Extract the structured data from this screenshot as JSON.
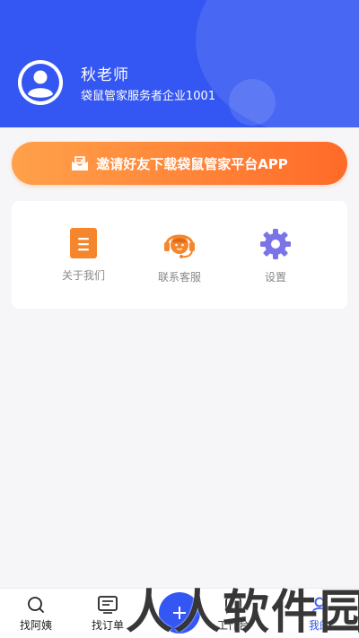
{
  "profile": {
    "name": "秋老师",
    "company": "袋鼠管家服务者企业1001"
  },
  "invite_banner": {
    "label": "邀请好友下载袋鼠管家平台APP",
    "icon": "envelope-icon"
  },
  "menu": [
    {
      "label": "关于我们",
      "icon": "document-icon",
      "color": "#f5862b"
    },
    {
      "label": "联系客服",
      "icon": "customer-service-icon",
      "color": "#f5862b"
    },
    {
      "label": "设置",
      "icon": "gear-icon",
      "color": "#7b74e8"
    }
  ],
  "tabbar": {
    "items": [
      {
        "label": "找阿姨",
        "icon": "search-icon"
      },
      {
        "label": "找订单",
        "icon": "order-list-icon"
      },
      {
        "label": "",
        "icon": "publish-icon"
      },
      {
        "label": "工作台",
        "icon": "workbench-icon"
      },
      {
        "label": "我的",
        "icon": "profile-icon",
        "active": true
      }
    ]
  },
  "watermark": {
    "text": "人人软件园"
  },
  "colors": {
    "primary": "#3456f2",
    "orange": "#ff7a33",
    "settings_purple": "#7b74e8"
  }
}
